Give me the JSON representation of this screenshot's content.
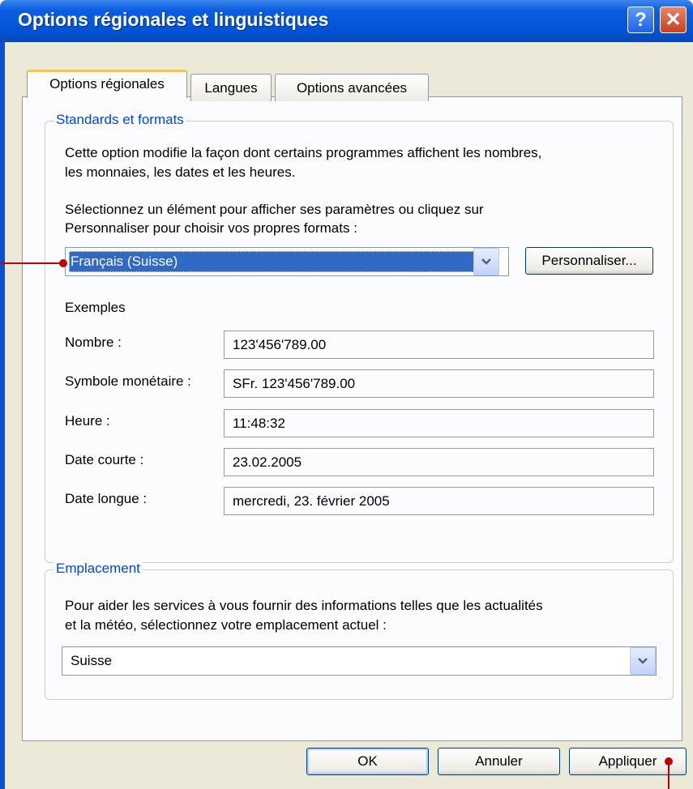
{
  "window": {
    "title": "Options régionales et linguistiques",
    "help_label": "?",
    "close_label": "✕"
  },
  "tabs": [
    "Options régionales",
    "Langues",
    "Options avancées"
  ],
  "standards": {
    "legend": "Standards et formats",
    "desc_line1": "Cette option modifie la façon dont certains programmes affichent les nombres,",
    "desc_line2": "les monnaies, les dates et les heures.",
    "select_line1": "Sélectionnez un élément pour afficher ses paramètres ou cliquez sur",
    "select_line2": "Personnaliser pour choisir vos propres formats :",
    "selected_format": "Français (Suisse)",
    "customize_label": "Personnaliser...",
    "examples_heading": "Exemples",
    "examples": [
      {
        "label": "Nombre :",
        "value": "123'456'789.00"
      },
      {
        "label": "Symbole monétaire :",
        "value": "SFr. 123'456'789.00"
      },
      {
        "label": "Heure :",
        "value": "11:48:32"
      },
      {
        "label": "Date courte :",
        "value": "23.02.2005"
      },
      {
        "label": "Date longue :",
        "value": "mercredi, 23. février 2005"
      }
    ]
  },
  "location": {
    "legend": "Emplacement",
    "desc_line1": "Pour aider les services à vous fournir des informations telles que les actualités",
    "desc_line2": "et la météo, sélectionnez votre emplacement actuel :",
    "selected_location": "Suisse"
  },
  "buttons": {
    "ok": "OK",
    "cancel": "Annuler",
    "apply": "Appliquer"
  },
  "icons": {
    "dropdown": "chevron-down-icon",
    "help": "help-icon",
    "close": "close-icon"
  },
  "colors": {
    "titlebar": "#0454d6",
    "selection": "#316ac5",
    "legend_text": "#0046d5",
    "callout": "#c00000"
  }
}
